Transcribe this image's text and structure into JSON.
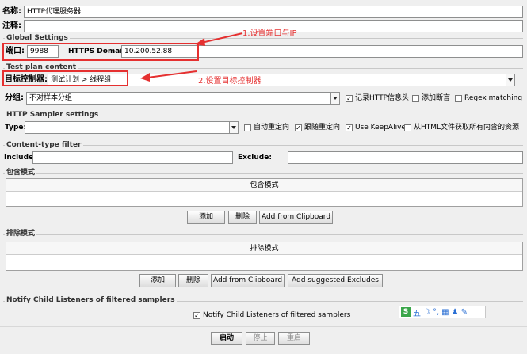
{
  "name_label": "名称:",
  "name_value": "HTTP代理服务器",
  "comment_label": "注释:",
  "global": {
    "title": "Global Settings",
    "port_label": "端口:",
    "port_value": "9988",
    "https_label": "HTTPS Domains :",
    "https_value": "10.200.52.88"
  },
  "annotation1": "1.设置端口与IP",
  "testplan": {
    "title": "Test plan content",
    "controller_label": "目标控制器:",
    "controller_value": "测试计划 > 线程组",
    "grouping_label": "分组:",
    "grouping_value": "不对样本分组",
    "record_headers": "记录HTTP信息头",
    "add_assertions": "添加断言",
    "regex_matching": "Regex matching"
  },
  "annotation2": "2.设置目标控制器",
  "sampler": {
    "title": "HTTP Sampler settings",
    "type_label": "Type:",
    "auto_redirect": "自动重定向",
    "follow_redirect": "跟随重定向",
    "keepalive": "Use KeepAlive",
    "fetch_resources": "从HTML文件获取所有内含的资源"
  },
  "content_filter": {
    "title": "Content-type filter",
    "include_label": "Include:",
    "exclude_label": "Exclude:"
  },
  "include_patterns": {
    "title": "包含模式",
    "header": "包含模式",
    "add": "添加",
    "delete": "删除",
    "clipboard": "Add from Clipboard"
  },
  "exclude_patterns": {
    "title": "排除模式",
    "header": "排除模式",
    "add": "添加",
    "delete": "删除",
    "clipboard": "Add from Clipboard",
    "suggested": "Add suggested Excludes"
  },
  "notify": {
    "title": "Notify Child Listeners of filtered samplers",
    "checkbox": "Notify Child Listeners of filtered samplers"
  },
  "ime_text": "五",
  "buttons": {
    "start": "启动",
    "stop": "停止",
    "restart": "重启"
  }
}
